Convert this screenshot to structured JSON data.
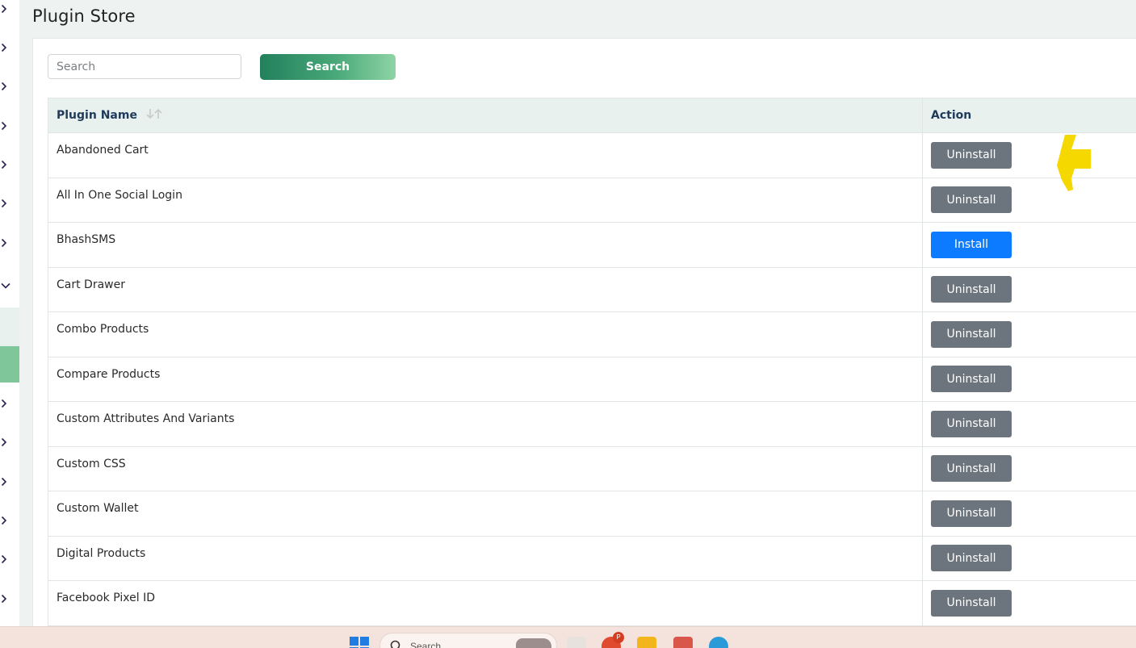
{
  "page": {
    "title": "Plugin Store"
  },
  "search": {
    "placeholder": "Search",
    "button_label": "Search"
  },
  "table": {
    "columns": {
      "plugin_name": "Plugin Name",
      "action": "Action"
    },
    "rows": [
      {
        "name": "Abandoned Cart",
        "action": "Uninstall"
      },
      {
        "name": "All In One Social Login",
        "action": "Uninstall"
      },
      {
        "name": "BhashSMS",
        "action": "Install"
      },
      {
        "name": "Cart Drawer",
        "action": "Uninstall"
      },
      {
        "name": "Combo Products",
        "action": "Uninstall"
      },
      {
        "name": "Compare Products",
        "action": "Uninstall"
      },
      {
        "name": "Custom Attributes And Variants",
        "action": "Uninstall"
      },
      {
        "name": "Custom CSS",
        "action": "Uninstall"
      },
      {
        "name": "Custom Wallet",
        "action": "Uninstall"
      },
      {
        "name": "Digital Products",
        "action": "Uninstall"
      },
      {
        "name": "Facebook Pixel ID",
        "action": "Uninstall"
      }
    ]
  },
  "taskbar": {
    "search_placeholder": "Search",
    "badge": "P"
  },
  "colors": {
    "accent_green": "#22805c",
    "install_blue": "#0d7bff",
    "uninstall_gray": "#6c757d",
    "header_bg": "#e8f1ee"
  },
  "icons": {
    "sidebar": [
      "chevron-right-icon",
      "chevron-down-icon"
    ],
    "sort": "sort-arrows-icon",
    "cursor": "hand-pointer-icon"
  }
}
